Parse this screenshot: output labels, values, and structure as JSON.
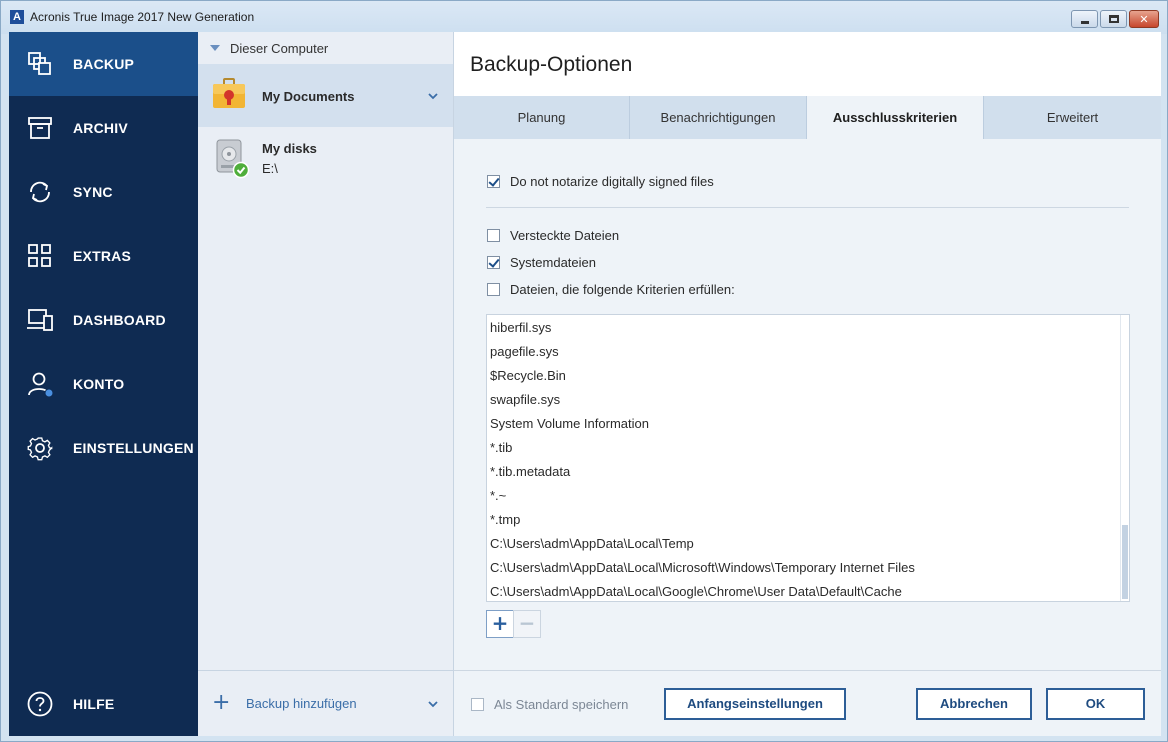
{
  "window": {
    "title": "Acronis True Image 2017 New Generation",
    "logo": "A"
  },
  "sidebar": {
    "items": [
      {
        "label": "BACKUP",
        "icon": "backup-icon"
      },
      {
        "label": "ARCHIV",
        "icon": "archive-icon"
      },
      {
        "label": "SYNC",
        "icon": "sync-icon"
      },
      {
        "label": "EXTRAS",
        "icon": "grid-icon"
      },
      {
        "label": "DASHBOARD",
        "icon": "dashboard-icon"
      },
      {
        "label": "KONTO",
        "icon": "user-icon"
      },
      {
        "label": "EINSTELLUNGEN",
        "icon": "gear-icon"
      }
    ],
    "help_label": "HILFE"
  },
  "sources": {
    "header": "Dieser Computer",
    "items": [
      {
        "title": "My Documents",
        "sub": ""
      },
      {
        "title": "My disks",
        "sub": "E:\\"
      }
    ],
    "add_label": "Backup hinzufügen"
  },
  "options": {
    "title": "Backup-Optionen",
    "tabs": [
      "Planung",
      "Benachrichtigungen",
      "Ausschlusskriterien",
      "Erweitert"
    ],
    "active_tab": "Ausschlusskriterien",
    "notarize_label": "Do not notarize digitally signed files",
    "hidden_label": "Versteckte Dateien",
    "system_label": "Systemdateien",
    "criteria_label": "Dateien, die folgende Kriterien erfüllen:",
    "exclusions": [
      "hiberfil.sys",
      "pagefile.sys",
      "$Recycle.Bin",
      "swapfile.sys",
      "System Volume Information",
      "*.tib",
      "*.tib.metadata",
      "*.~",
      "*.tmp",
      "C:\\Users\\adm\\AppData\\Local\\Temp",
      "C:\\Users\\adm\\AppData\\Local\\Microsoft\\Windows\\Temporary Internet Files",
      "C:\\Users\\adm\\AppData\\Local\\Google\\Chrome\\User Data\\Default\\Cache"
    ],
    "add_symbol": "+",
    "remove_symbol": "−"
  },
  "footer": {
    "save_default_label": "Als Standard speichern",
    "reset_label": "Anfangseinstellungen",
    "cancel_label": "Abbrechen",
    "ok_label": "OK"
  }
}
